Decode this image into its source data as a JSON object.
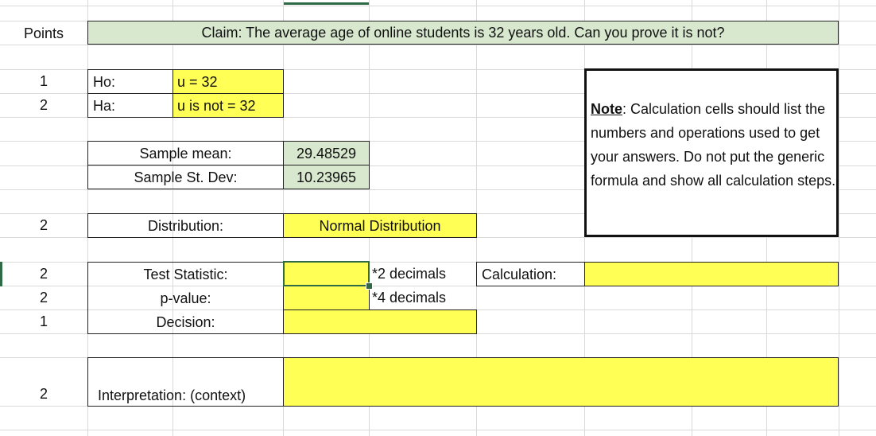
{
  "header": {
    "points_label": "Points"
  },
  "claim": "Claim: The average age of online students is 32 years old. Can you prove it is not?",
  "points": [
    "1",
    "2",
    "2",
    "2",
    "2",
    "1",
    "2"
  ],
  "hypotheses": {
    "ho_label": "Ho:",
    "ho_value": "u = 32",
    "ha_label": "Ha:",
    "ha_value": "u is not = 32"
  },
  "sample": {
    "mean_label": "Sample mean:",
    "mean_value": "29.48529",
    "sd_label": "Sample St. Dev:",
    "sd_value": "10.23965"
  },
  "distribution": {
    "label": "Distribution:",
    "value": "Normal Distribution"
  },
  "test": {
    "statistic_label": "Test Statistic:",
    "statistic_note": "*2 decimals",
    "pvalue_label": "p-value:",
    "pvalue_note": "*4 decimals",
    "decision_label": "Decision:",
    "calculation_label": "Calculation:"
  },
  "interpretation_label": "Interpretation: (context)",
  "note": {
    "label": "Note",
    "text": ": Calculation cells should list the numbers and operations used to get your answers. Do not put the generic formula and show all calculation steps."
  },
  "colors": {
    "input_yellow": "#ffff55",
    "given_green": "#d8e8cf",
    "selection": "#2d6a45"
  }
}
